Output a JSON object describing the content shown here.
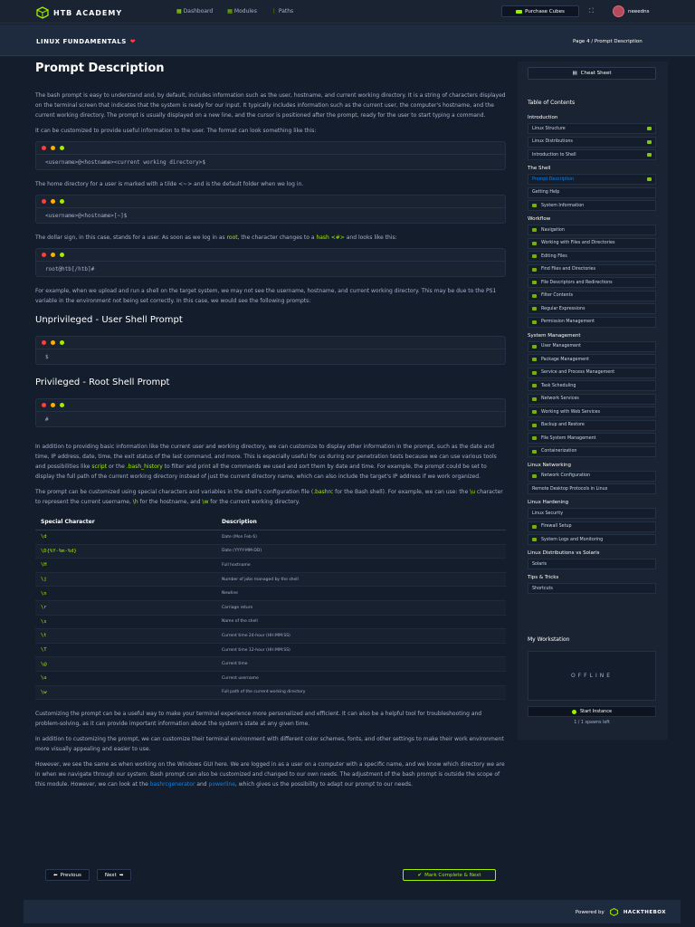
{
  "colors": {
    "bg": "#141d2b",
    "panel": "#1a2332",
    "accent": "#9fef00",
    "link": "#0086ff",
    "heart": "#ff3e3e"
  },
  "topbar": {
    "logo": "HTB ACADEMY",
    "nav": [
      {
        "icon": "dashboard-icon",
        "label": "Dashboard"
      },
      {
        "icon": "modules-icon",
        "label": "Modules"
      },
      {
        "icon": "paths-icon",
        "label": "Paths"
      }
    ],
    "purchase_label": "Purchase Cubes",
    "username": "neeedns"
  },
  "subbar": {
    "module": "LINUX FUNDAMENTALS",
    "page": "Page 4",
    "separator": "/",
    "section": "Prompt Description"
  },
  "content": {
    "title": "Prompt Description",
    "p1": "The bash prompt is easy to understand and, by default, includes information such as the user, hostname, and current working directory. It is a string of characters displayed on the terminal screen that indicates that the system is ready for our input. It typically includes information such as the current user, the computer's hostname, and the current working directory. The prompt is usually displayed on a new line, and the cursor is positioned after the prompt, ready for the user to start typing a command.",
    "p2": "It can be customized to provide useful information to the user. The format can look something like this:",
    "code1": "<username>@<hostname><current working directory>$",
    "p3": "The home directory for a user is marked with a tilde <~> and is the default folder when we log in.",
    "code2": "<username>@<hostname>[~]$",
    "p4a": "The dollar sign, in this case, stands for a user. As soon as we log in as ",
    "p4root": "root",
    "p4b": ", the character changes to a ",
    "p4hash": "hash <#>",
    "p4c": " and looks like this:",
    "code3": "root@htb[/htb]#",
    "p5": "For example, when we upload and run a shell on the target system, we may not see the username, hostname, and current working directory. This may be due to the PS1 variable in the environment not being set correctly. In this case, we would see the following prompts:",
    "h_unpriv": "Unprivileged - User Shell Prompt",
    "code4": "$",
    "h_priv": "Privileged - Root Shell Prompt",
    "code5": "#",
    "p6a": "In addition to providing basic information like the current user and working directory, we can customize to display other information in the prompt, such as the date and time, IP address, date, time, the exit status of the last command, and more. This is especially useful for us during our penetration tests because we can use various tools and possibilities like ",
    "p6script": "script",
    "p6b": " or the ",
    "p6hist": ".bash_history",
    "p6c": " to filter and print all the commands we used and sort them by date and time. For example, the prompt could be set to display the full path of the current working directory instead of just the current directory name, which can also include the target's IP address if we work organized.",
    "p7a": "The prompt can be customized using special characters and variables in the shell's configuration file (",
    "p7bashrc": ".bashrc",
    "p7b": " for the Bash shell). For example, we can use: the ",
    "p7u": "\\u",
    "p7c": " character to represent the current username, ",
    "p7h": "\\h",
    "p7d": " for the hostname, and ",
    "p7w": "\\w",
    "p7e": " for the current working directory.",
    "table": {
      "headers": [
        "Special Character",
        "Description"
      ],
      "rows": [
        [
          "\\d",
          "Date (Mon Feb 6)"
        ],
        [
          "\\D{%Y-%m-%d}",
          "Date (YYYY-MM-DD)"
        ],
        [
          "\\H",
          "Full hostname"
        ],
        [
          "\\j",
          "Number of jobs managed by the shell"
        ],
        [
          "\\n",
          "Newline"
        ],
        [
          "\\r",
          "Carriage return"
        ],
        [
          "\\s",
          "Name of the shell"
        ],
        [
          "\\t",
          "Current time 24-hour (HH:MM:SS)"
        ],
        [
          "\\T",
          "Current time 12-hour (HH:MM:SS)"
        ],
        [
          "\\@",
          "Current time"
        ],
        [
          "\\u",
          "Current username"
        ],
        [
          "\\w",
          "Full path of the current working directory"
        ]
      ]
    },
    "p8": "Customizing the prompt can be a useful way to make your terminal experience more personalized and efficient. It can also be a helpful tool for troubleshooting and problem-solving, as it can provide important information about the system's state at any given time.",
    "p9": "In addition to customizing the prompt, we can customize their terminal environment with different color schemes, fonts, and other settings to make their work environment more visually appealing and easier to use.",
    "p10a": "However, we see the same as when working on the Windows GUI here. We are logged in as a user on a computer with a specific name, and we know which directory we are in when we navigate through our system. Bash prompt can also be customized and changed to our own needs. The adjustment of the bash prompt is outside the scope of this module. However, we can look at the ",
    "p10link1": "bashrcgenerator",
    "p10b": " and ",
    "p10link2": "powerline",
    "p10c": ", which gives us the possibility to adapt our prompt to our needs."
  },
  "pager": {
    "previous": "Previous",
    "next": "Next",
    "complete": "Mark Complete & Next"
  },
  "footer": {
    "powered": "Powered by",
    "brand": "HACKTHEBOX"
  },
  "sidebar": {
    "cheat_sheet": "Cheat Sheet",
    "toc_title": "Table of Contents",
    "sections": [
      {
        "title": "Introduction",
        "items": [
          {
            "label": "Linux Structure",
            "done": true,
            "icon": false
          },
          {
            "label": "Linux Distributions",
            "done": true,
            "icon": false
          },
          {
            "label": "Introduction to Shell",
            "done": true,
            "icon": false
          }
        ]
      },
      {
        "title": "The Shell",
        "items": [
          {
            "label": "Prompt Description",
            "done": true,
            "icon": false,
            "active": true
          },
          {
            "label": "Getting Help",
            "done": false,
            "icon": false
          },
          {
            "label": "System Information",
            "done": false,
            "icon": true
          }
        ]
      },
      {
        "title": "Workflow",
        "items": [
          {
            "label": "Navigation",
            "done": false,
            "icon": true
          },
          {
            "label": "Working with Files and Directories",
            "done": false,
            "icon": true
          },
          {
            "label": "Editing Files",
            "done": false,
            "icon": true
          },
          {
            "label": "Find Files and Directories",
            "done": false,
            "icon": true
          },
          {
            "label": "File Descriptors and Redirections",
            "done": false,
            "icon": true
          },
          {
            "label": "Filter Contents",
            "done": false,
            "icon": true
          },
          {
            "label": "Regular Expressions",
            "done": false,
            "icon": true
          },
          {
            "label": "Permission Management",
            "done": false,
            "icon": true
          }
        ]
      },
      {
        "title": "System Management",
        "items": [
          {
            "label": "User Management",
            "done": false,
            "icon": true
          },
          {
            "label": "Package Management",
            "done": false,
            "icon": true
          },
          {
            "label": "Service and Process Management",
            "done": false,
            "icon": true
          },
          {
            "label": "Task Scheduling",
            "done": false,
            "icon": true
          },
          {
            "label": "Network Services",
            "done": false,
            "icon": true
          },
          {
            "label": "Working with Web Services",
            "done": false,
            "icon": true
          },
          {
            "label": "Backup and Restore",
            "done": false,
            "icon": true
          },
          {
            "label": "File System Management",
            "done": false,
            "icon": true
          },
          {
            "label": "Containerization",
            "done": false,
            "icon": true
          }
        ]
      },
      {
        "title": "Linux Networking",
        "items": [
          {
            "label": "Network Configuration",
            "done": false,
            "icon": true
          },
          {
            "label": "Remote Desktop Protocols in Linux",
            "done": false,
            "icon": false
          }
        ]
      },
      {
        "title": "Linux Hardening",
        "items": [
          {
            "label": "Linux Security",
            "done": false,
            "icon": false
          },
          {
            "label": "Firewall Setup",
            "done": false,
            "icon": true
          },
          {
            "label": "System Logs and Monitoring",
            "done": false,
            "icon": true
          }
        ]
      },
      {
        "title": "Linux Distributions vs Solaris",
        "items": [
          {
            "label": "Solaris",
            "done": false,
            "icon": false
          }
        ]
      },
      {
        "title": "Tips & Tricks",
        "items": [
          {
            "label": "Shortcuts",
            "done": false,
            "icon": false
          }
        ]
      }
    ]
  },
  "workstation": {
    "title": "My Workstation",
    "status": "OFFLINE",
    "start_label": "Start Instance",
    "spawns": "1 / 1 spawns left"
  }
}
